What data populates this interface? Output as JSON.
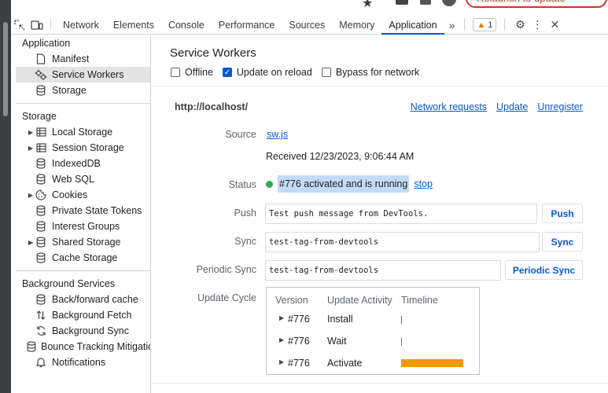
{
  "browser": {
    "relaunch_label": "Relaunch to update"
  },
  "toolbar": {
    "tabs": [
      "Network",
      "Elements",
      "Console",
      "Performance",
      "Sources",
      "Memory",
      "Application"
    ],
    "active_tab": "Application",
    "more_tabs_icon": "chevron-double-right-icon",
    "warning_count": "1",
    "icons": [
      "inspect-element-icon",
      "device-toolbar-icon",
      "gear-icon",
      "kebab-menu-icon",
      "close-icon"
    ]
  },
  "sidebar": {
    "sections": [
      {
        "title": "Application",
        "items": [
          {
            "label": "Manifest",
            "icon": "file-icon",
            "expandable": false,
            "selected": false
          },
          {
            "label": "Service Workers",
            "icon": "gears-icon",
            "expandable": false,
            "selected": true
          },
          {
            "label": "Storage",
            "icon": "database-icon",
            "expandable": false,
            "selected": false
          }
        ]
      },
      {
        "title": "Storage",
        "items": [
          {
            "label": "Local Storage",
            "icon": "table-icon",
            "expandable": true,
            "selected": false
          },
          {
            "label": "Session Storage",
            "icon": "table-icon",
            "expandable": true,
            "selected": false
          },
          {
            "label": "IndexedDB",
            "icon": "database-icon",
            "expandable": false,
            "selected": false
          },
          {
            "label": "Web SQL",
            "icon": "database-icon",
            "expandable": false,
            "selected": false
          },
          {
            "label": "Cookies",
            "icon": "cookie-icon",
            "expandable": true,
            "selected": false
          },
          {
            "label": "Private State Tokens",
            "icon": "database-icon",
            "expandable": false,
            "selected": false
          },
          {
            "label": "Interest Groups",
            "icon": "database-icon",
            "expandable": false,
            "selected": false
          },
          {
            "label": "Shared Storage",
            "icon": "database-icon",
            "expandable": true,
            "selected": false
          },
          {
            "label": "Cache Storage",
            "icon": "database-icon",
            "expandable": false,
            "selected": false
          }
        ]
      },
      {
        "title": "Background Services",
        "items": [
          {
            "label": "Back/forward cache",
            "icon": "database-icon",
            "expandable": false,
            "selected": false
          },
          {
            "label": "Background Fetch",
            "icon": "up-down-arrows-icon",
            "expandable": false,
            "selected": false
          },
          {
            "label": "Background Sync",
            "icon": "sync-icon",
            "expandable": false,
            "selected": false
          },
          {
            "label": "Bounce Tracking Mitigations",
            "icon": "database-icon",
            "expandable": false,
            "selected": false
          },
          {
            "label": "Notifications",
            "icon": "bell-icon",
            "expandable": false,
            "selected": false
          }
        ]
      }
    ]
  },
  "main": {
    "title": "Service Workers",
    "options": [
      {
        "label": "Offline",
        "checked": false
      },
      {
        "label": "Update on reload",
        "checked": true
      },
      {
        "label": "Bypass for network",
        "checked": false
      }
    ],
    "origin": "http://localhost/",
    "origin_links": [
      "Network requests",
      "Update",
      "Unregister"
    ],
    "source_label": "Source",
    "source_file": "sw.js",
    "received": "Received 12/23/2023, 9:06:44 AM",
    "status_label": "Status",
    "status_text": "#776 activated and is running",
    "status_color": "#34a853",
    "stop_label": "stop",
    "push_label": "Push",
    "push_value": "Test push message from DevTools.",
    "push_button": "Push",
    "sync_label": "Sync",
    "sync_value": "test-tag-from-devtools",
    "sync_button": "Sync",
    "periodic_label": "Periodic Sync",
    "periodic_value": "test-tag-from-devtools",
    "periodic_button": "Periodic Sync",
    "update_cycle_label": "Update Cycle",
    "update_cycle": {
      "headers": [
        "Version",
        "Update Activity",
        "Timeline"
      ],
      "rows": [
        {
          "version": "#776",
          "activity": "Install",
          "timeline_color": "#1a73e8"
        },
        {
          "version": "#776",
          "activity": "Wait",
          "timeline_color": "#a142f4"
        },
        {
          "version": "#776",
          "activity": "Activate",
          "timeline_color": "#f29900"
        }
      ]
    }
  }
}
